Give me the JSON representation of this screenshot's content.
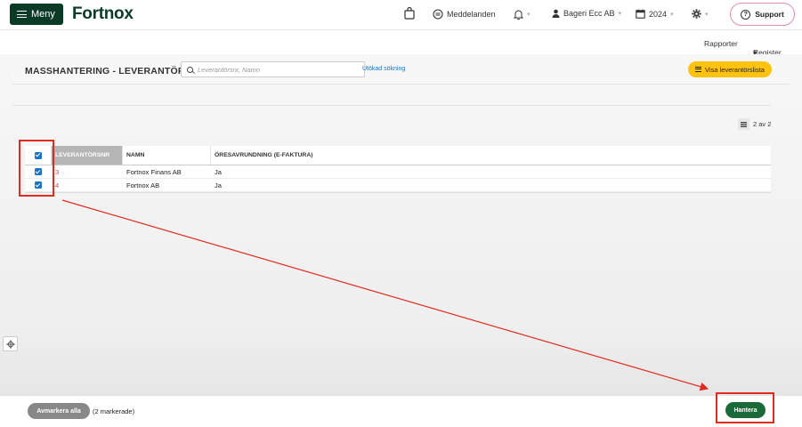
{
  "topbar": {
    "menu_label": "Meny",
    "logo_text": "Fortnox",
    "messages_label": "Meddelanden",
    "company": "Bageri Ecc AB",
    "year": "2024",
    "support_label": "Support"
  },
  "subnav": {
    "reports": "Rapporter",
    "register": "Register"
  },
  "page": {
    "title": "MASSHANTERING - LEVERANTÖRER",
    "search_placeholder": "Leverantörsnr, Namn",
    "advanced_search": "Utökad sökning",
    "show_list_button": "Visa leverantörslista",
    "pager_text": "2 av 2"
  },
  "table": {
    "columns": [
      "LEVERANTÖRSNR",
      "NAMN",
      "ÖRESAVRUNDNING (E-FAKTURA)"
    ],
    "rows": [
      {
        "nr": "3",
        "name": "Fortnox Finans AB",
        "rounding": "Ja",
        "checked": true
      },
      {
        "nr": "4",
        "name": "Fortnox AB",
        "rounding": "Ja",
        "checked": true
      }
    ]
  },
  "bottom": {
    "unmark_all": "Avmarkera alla",
    "marked_count": "(2 markerade)",
    "handle_button": "Hantera"
  },
  "colors": {
    "brand_green": "#0b3b26",
    "accent_yellow": "#ffc20e",
    "link_blue": "#1a73c9",
    "annotation_red": "#e02b20",
    "action_green": "#1b6b3a"
  },
  "icons": [
    "hamburger-icon",
    "shopping-bag-icon",
    "message-icon",
    "bell-icon",
    "user-icon",
    "calendar-icon",
    "gear-icon",
    "question-icon",
    "search-icon",
    "list-icon"
  ]
}
